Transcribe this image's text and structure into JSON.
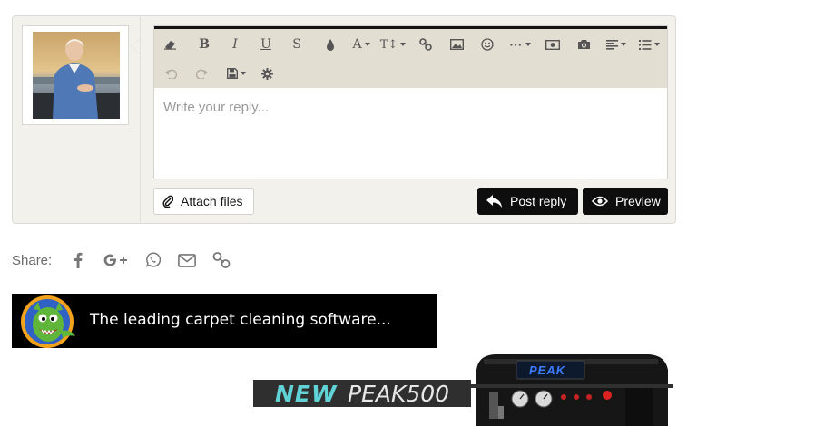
{
  "editor": {
    "placeholder": "Write your reply...",
    "toolbar_row1": [
      "eraser-icon",
      "bold-icon",
      "italic-icon",
      "underline-icon",
      "strikethrough-icon",
      "text-color-icon",
      "font-family-icon",
      "font-size-icon",
      "link-icon",
      "image-icon",
      "smilie-icon",
      "more-icon",
      "media-icon",
      "camera-icon",
      "align-icon",
      "list-icon"
    ],
    "toolbar_row2": [
      "undo-icon",
      "redo-icon",
      "save-drafts-icon",
      "settings-icon"
    ]
  },
  "buttons": {
    "attach": "Attach files",
    "post_reply": "Post reply",
    "preview": "Preview"
  },
  "share": {
    "label": "Share:",
    "icons": [
      "facebook-icon",
      "google-plus-icon",
      "whatsapp-icon",
      "email-icon",
      "link-icon"
    ]
  },
  "ads": {
    "banner1_text": "The leading carpet cleaning software...",
    "banner2_new": "NEW",
    "banner2_model": "PEAK500",
    "banner2_machine_label": "PEAK"
  },
  "colors": {
    "toolbar_bg": "#e3ded2",
    "panel_bg": "#f3f1ec",
    "button_dark": "#0e0e0e",
    "accent_teal": "#5fd3d6"
  }
}
